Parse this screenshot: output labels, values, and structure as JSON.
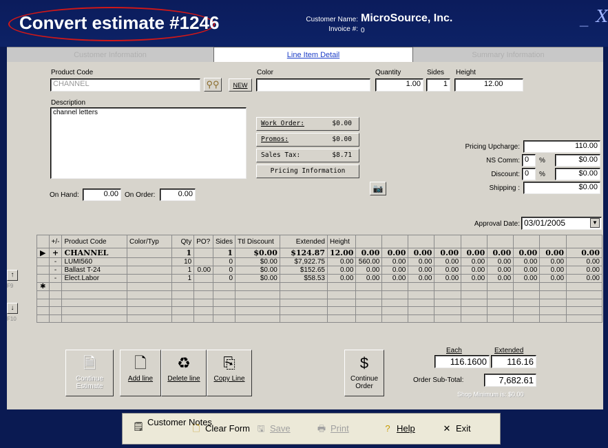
{
  "window": {
    "title": "Convert estimate #1246",
    "customer_label": "Customer Name:",
    "customer_name": "MicroSource, Inc.",
    "invoice_label": "Invoice #:",
    "invoice_value": "0",
    "minimize": "_",
    "close": "X"
  },
  "tabs": [
    {
      "label": "Customer Information"
    },
    {
      "label": "Line Item Detail"
    },
    {
      "label": "Summary Information"
    }
  ],
  "form": {
    "product_code_label": "Product Code",
    "product_code_value": "CHANNEL",
    "new_button": "NEW",
    "color_label": "Color",
    "color_value": "",
    "quantity_label": "Quantity",
    "quantity_value": "1.00",
    "sides_label": "Sides",
    "sides_value": "1",
    "height_label": "Height",
    "height_value": "12.00",
    "description_label": "Description",
    "description_value": "channel letters",
    "on_hand_label": "On Hand:",
    "on_hand_value": "0.00",
    "on_order_label": "On Order:",
    "on_order_value": "0.00",
    "work_order_label": "Work Order:",
    "work_order_value": "$0.00",
    "promos_label": "Promos:",
    "promos_value": "$0.00",
    "sales_tax_label": "Sales Tax:",
    "sales_tax_value": "$8.71",
    "pricing_info_button": "Pricing Information",
    "pricing_upcharge_label": "Pricing Upcharge:",
    "pricing_upcharge_value": "110.00",
    "ns_comm_label": "NS Comm:",
    "ns_comm_pct": "0",
    "ns_comm_value": "$0.00",
    "discount_label": "Discount:",
    "discount_pct": "0",
    "discount_value": "$0.00",
    "shipping_label": "Shipping :",
    "shipping_value": "$0.00",
    "percent_sign": "%",
    "approval_label": "Approval Date:",
    "approval_value": "03/01/2005"
  },
  "grid": {
    "headers": [
      "+/-",
      "Product Code",
      "Color/Typ",
      "Qty",
      "PO?",
      "Sides",
      "Ttl Discount",
      "Extended",
      "Height",
      "",
      "",
      "",
      "",
      "",
      "",
      "",
      "",
      ""
    ],
    "rows": [
      [
        "+",
        "CHANNEL",
        "",
        "1",
        "",
        "1",
        "$0.00",
        "$124.87",
        "12.00",
        "0.00",
        "0.00",
        "0.00",
        "0.00",
        "0.00",
        "0.00",
        "0.00",
        "0.00",
        "0.00"
      ],
      [
        "-",
        "LUMI560",
        "",
        "10",
        "",
        "0",
        "$0.00",
        "$7,922.75",
        "0.00",
        "560.00",
        "0.00",
        "0.00",
        "0.00",
        "0.00",
        "0.00",
        "0.00",
        "0.00",
        "0.00"
      ],
      [
        "-",
        "Ballast T-24",
        "",
        "1",
        "0.00",
        "0",
        "$0.00",
        "$152.65",
        "0.00",
        "0.00",
        "0.00",
        "0.00",
        "0.00",
        "0.00",
        "0.00",
        "0.00",
        "0.00",
        "0.00"
      ],
      [
        "-",
        "Elect.Labor",
        "",
        "1",
        "",
        "0",
        "$0.00",
        "$58.53",
        "0.00",
        "0.00",
        "0.00",
        "0.00",
        "0.00",
        "0.00",
        "0.00",
        "0.00",
        "0.00",
        "0.00"
      ]
    ],
    "nav_keys": [
      "F9",
      "F10"
    ]
  },
  "actions": {
    "continue_estimate": "Continue Estimate",
    "add_line": "Add line",
    "delete_line": "Delete line",
    "copy_line": "Copy Line",
    "continue_order": "Continue Order"
  },
  "totals": {
    "each_label": "Each",
    "each_value": "116.1600",
    "extended_label": "Extended",
    "extended_value": "116.16",
    "subtotal_label": "Order Sub-Total:",
    "subtotal_value": "7,682.61",
    "shop_minimum": "Shop Minimum is: $0.00"
  },
  "toolbar": {
    "customer_notes": "Customer Notes",
    "clear_form": "Clear Form",
    "save": "Save",
    "print": "Print",
    "help": "Help",
    "exit": "Exit"
  }
}
